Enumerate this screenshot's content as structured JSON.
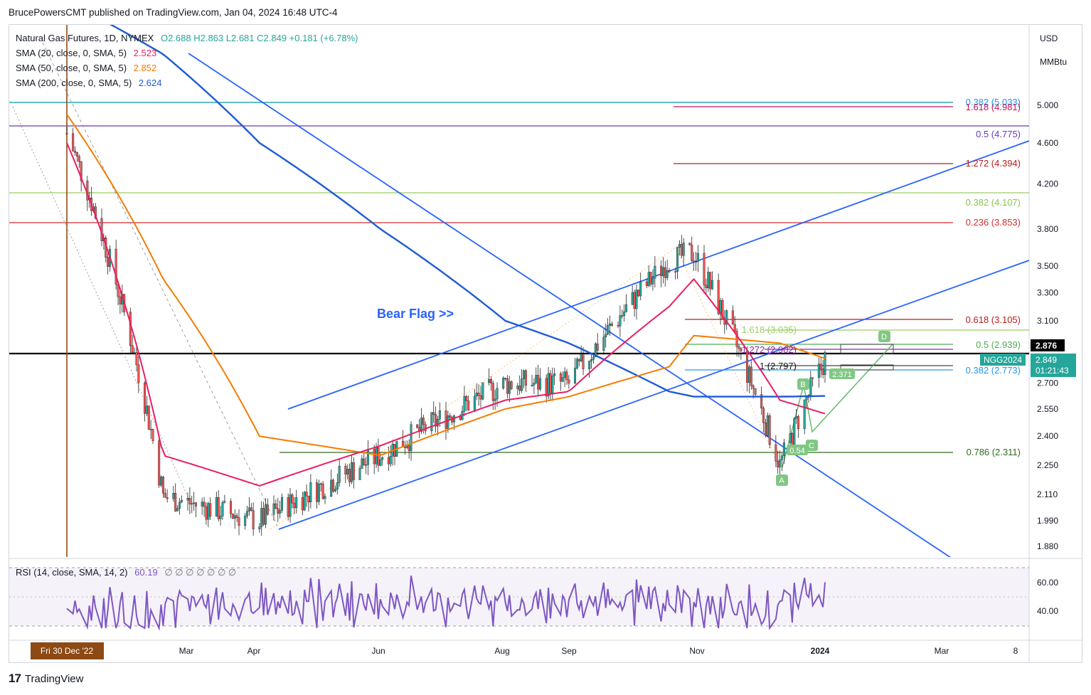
{
  "header": {
    "publisher": "BrucePowersCMT published on TradingView.com, Jan 04, 2024 16:48 UTC-4"
  },
  "legend": {
    "symbol": "Natural Gas Futures, 1D, NYMEX",
    "ohlc": "O2.688  H2.863  L2.681  C2.849  +0.181 (+6.78%)",
    "sma20_label": "SMA (20, close, 0, SMA, 5)",
    "sma20_value": "2.523",
    "sma50_label": "SMA (50, close, 0, SMA, 5)",
    "sma50_value": "2.852",
    "sma200_label": "SMA (200, close, 0, SMA, 5)",
    "sma200_value": "2.624",
    "rsi_label": "RSI (14, close, SMA, 14, 2)",
    "rsi_value": "60.19",
    "rsi_extra": "∅ ∅ ∅ ∅ ∅ ∅ ∅"
  },
  "axis": {
    "currency": "USD",
    "unit": "MMBtu",
    "price_ticks": [
      "5.000",
      "4.600",
      "4.200",
      "3.800",
      "3.500",
      "3.300",
      "3.100",
      "2.700",
      "2.550",
      "2.400",
      "2.250",
      "2.110",
      "1.990",
      "1.880"
    ],
    "rsi_ticks": [
      "60.00",
      "40.00"
    ],
    "time_labels": [
      "Mar",
      "Apr",
      "Jun",
      "Aug",
      "Sep",
      "Nov",
      "2024",
      "Mar",
      "8"
    ],
    "current_date_label": "Fri 30 Dec '22",
    "last_price": "2.876",
    "symbol_tag": "NGG2024",
    "close_price": "2.849",
    "countdown": "01:21:43"
  },
  "fib_labels": [
    {
      "text": "0.382 (5.033)",
      "color": "#2196f3"
    },
    {
      "text": "1.618 (4.981)",
      "color": "#c2185b"
    },
    {
      "text": "0.5 (4.775)",
      "color": "#673ab7"
    },
    {
      "text": "1.272 (4.394)",
      "color": "#b71c1c"
    },
    {
      "text": "0.382 (4.107)",
      "color": "#8bc34a"
    },
    {
      "text": "0.236 (3.853)",
      "color": "#d32f2f"
    },
    {
      "text": "0.618 (3.105)",
      "color": "#b71c1c"
    },
    {
      "text": "1.618 (3.035)",
      "color": "#9ccc65"
    },
    {
      "text": "0.5 (2.939)",
      "color": "#4caf50"
    },
    {
      "text": "1.272 (2.902)",
      "color": "#8e24aa"
    },
    {
      "text": "1 (2.797)",
      "color": "#131722"
    },
    {
      "text": "0.382 (2.773)",
      "color": "#2196f3"
    },
    {
      "text": "0.786 (2.311)",
      "color": "#33691e"
    }
  ],
  "annotations": {
    "bear_flag": "Bear Flag >>",
    "points": [
      "A",
      "B",
      "C",
      "D"
    ],
    "ratio_054": "0.54",
    "ratio_2371": "2.371"
  },
  "colors": {
    "sma20": "#e91e63",
    "sma50": "#f57c00",
    "sma200": "#1e5bd6",
    "channel": "#2962ff",
    "bull": "#26a69a",
    "bear": "#ef5350",
    "rsi": "#7e57c2"
  },
  "chart_data": {
    "type": "line",
    "x": [
      "2022-12-30",
      "2023-02-15",
      "2023-04-03",
      "2023-06-01",
      "2023-08-01",
      "2023-09-01",
      "2023-10-20",
      "2023-11-01",
      "2023-12-13",
      "2024-01-04"
    ],
    "series": [
      {
        "name": "Natural Gas Futures",
        "values": [
          4.7,
          2.1,
          1.99,
          2.3,
          2.7,
          2.7,
          3.55,
          3.6,
          2.25,
          2.849
        ]
      },
      {
        "name": "SMA (20, close, 0, SMA, 5)",
        "values": [
          4.6,
          2.3,
          2.15,
          2.35,
          2.6,
          2.65,
          3.2,
          3.4,
          2.6,
          2.523
        ]
      },
      {
        "name": "SMA (50, close, 0, SMA, 5)",
        "values": [
          4.9,
          3.4,
          2.4,
          2.3,
          2.55,
          2.62,
          2.8,
          3.0,
          2.95,
          2.852
        ]
      },
      {
        "name": "SMA (200, close, 0, SMA, 5)",
        "values": [
          6.3,
          5.6,
          4.6,
          3.8,
          3.1,
          2.95,
          2.65,
          2.62,
          2.62,
          2.624
        ]
      }
    ],
    "rsi": {
      "label": "RSI (14, close, SMA, 14, 2)",
      "last": 60.19
    }
  }
}
